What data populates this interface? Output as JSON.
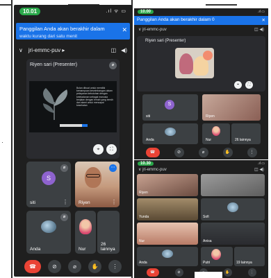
{
  "left_phone": {
    "status_time": "10.01",
    "status_icons": ".ıl ᯤ ▭",
    "banner": {
      "text": "Panggilan Anda akan berakhir dalam",
      "subtext": "waktu kurang dari satu menit"
    },
    "meeting_code": "jri-emmc-puv",
    "presenter_label": "Riyen sari (Presenter)",
    "slide_text": "Bulan dibuat untuk memiliki kemampuan keseimbangan dalam pelayanan kebutuhan dengan keteladanan sebagai manusia berjalan dengan lemah yang bersih dan alami untuk mencapai kesehatan",
    "tiles": [
      {
        "name": "siti",
        "avatar_letter": "S"
      },
      {
        "name": "Riyen"
      },
      {
        "name": "Anda"
      },
      {
        "name": "Nur"
      }
    ],
    "others_label": "26 lainnya"
  },
  "right_top_phone": {
    "status_time": "10.00",
    "banner_text": "Panggilan Anda akan berakhir dalam 0",
    "meeting_code": "jri-emmc-puv",
    "presenter_label": "Riyen sari (Presenter)",
    "tiles": [
      {
        "name": "siti",
        "avatar_letter": "S"
      },
      {
        "name": "Riyen"
      },
      {
        "name": "Anda"
      },
      {
        "name": "Nur"
      }
    ],
    "others_label": "26 lainnya"
  },
  "right_bottom_phone": {
    "status_time": "10.30",
    "meeting_code": "jri-emmc-puv",
    "tiles": [
      {
        "name": "Riyen"
      },
      {
        "name": ""
      },
      {
        "name": "Yunda"
      },
      {
        "name": "Sofi"
      },
      {
        "name": "Nur"
      },
      {
        "name": "Anisa"
      },
      {
        "name": "Anda"
      },
      {
        "name": "Putri"
      }
    ],
    "others_label": "19 lainnya"
  },
  "colors": {
    "accent": "#1a73e8",
    "end_call": "#ea4335",
    "time_pill": "#2aa84a",
    "tile_bg": "#3c4043",
    "screen_bg": "#1f1f1f"
  }
}
